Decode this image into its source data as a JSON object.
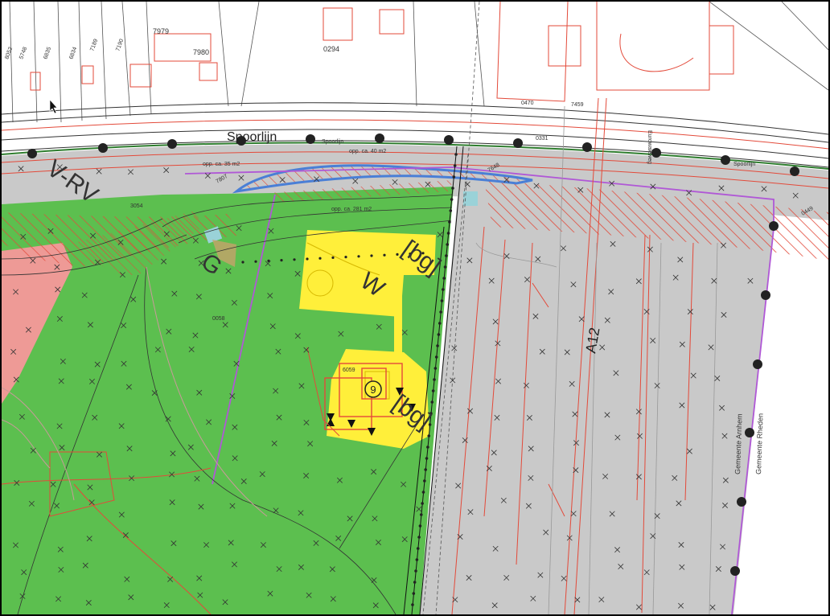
{
  "map": {
    "zones": {
      "railway_label": "V-RV",
      "green_label": "G",
      "residential_label": "W",
      "bg_label_1": "[bg]",
      "bg_label_2": "[bg]",
      "road_label": "A12",
      "height_marker": "9"
    },
    "text_labels": {
      "spoorlijn_big": "Spoorlijn",
      "spoorlijn_small_1": "Spoorlijn",
      "spoorlijn_small_2": "Spoorlijn",
      "area_1": "opp. ca. 35 m2",
      "area_2": "opp. ca. 40 m2",
      "area_3": "opp. ca. 281 m2",
      "gemeente_arnhem": "Gemeente Arnhem",
      "gemeente_rheden": "Gemeente Rheden",
      "eurowaleweg": "Eurowaleweg"
    },
    "parcel_numbers": [
      "7979",
      "7980",
      "0294",
      "8052",
      "5748",
      "6835",
      "6834",
      "7189",
      "7190",
      "0470",
      "7459",
      "0331",
      "7807",
      "7648",
      "3054",
      "0058",
      "6059",
      "0449"
    ],
    "colors": {
      "green_zone": "#5cbf4f",
      "road_grey": "#c9c9c9",
      "residential_yellow": "#ffef3a",
      "red_zone": "#ee9a96",
      "cadastral_red": "#e34a3a",
      "blue_outline": "#4a7fd6",
      "purple_boundary": "#b058d6"
    }
  }
}
